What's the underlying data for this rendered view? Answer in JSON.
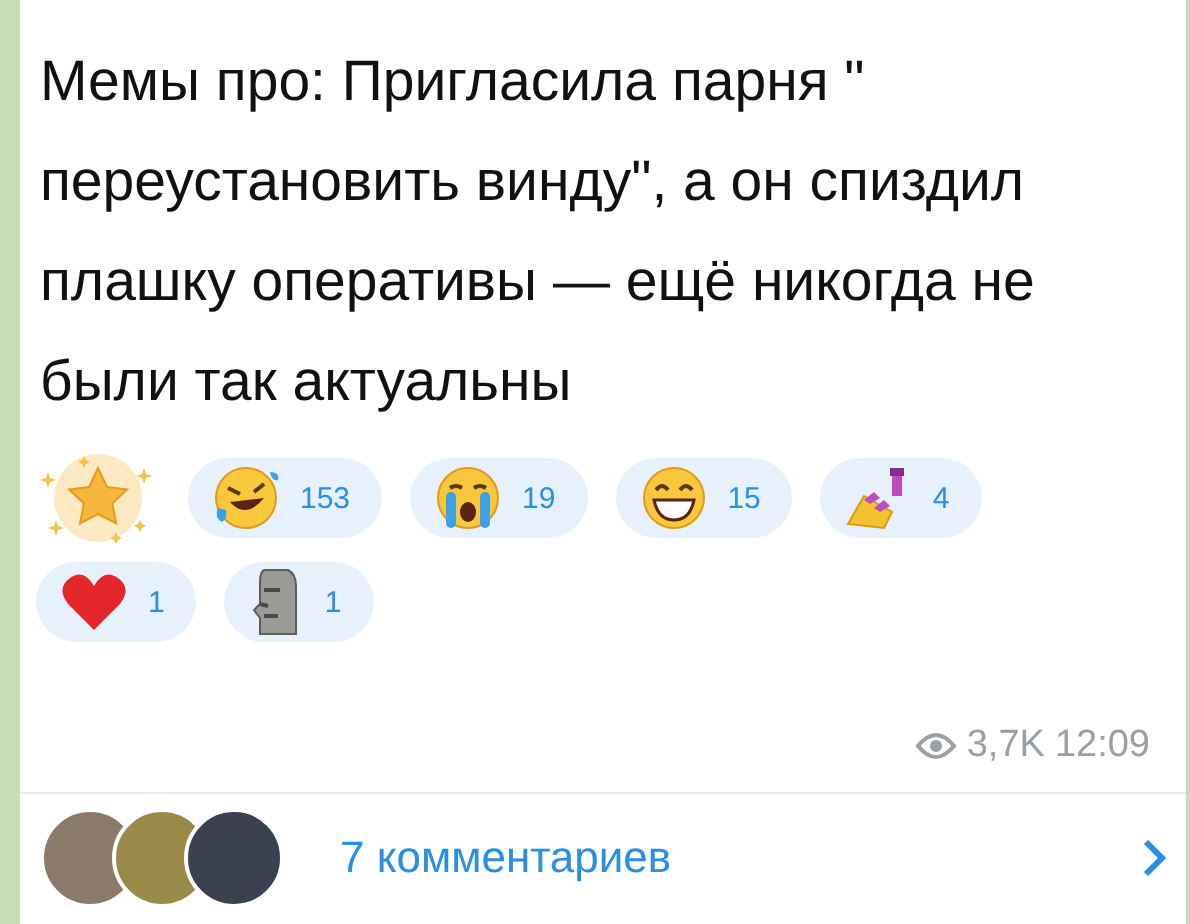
{
  "message": {
    "text": "Мемы про: Пригласила парня \" переустановить винду\", а он спиздил плашку оперативы — ещё никогда не были так актуальны",
    "reactions": [
      {
        "kind": "paid",
        "selected": false
      },
      {
        "kind": "emoji",
        "count": "153",
        "selected": false
      },
      {
        "kind": "emoji",
        "count": "19",
        "selected": false
      },
      {
        "kind": "emoji",
        "count": "15",
        "selected": false
      },
      {
        "kind": "emoji",
        "count": "4",
        "selected": false
      },
      {
        "kind": "emoji",
        "count": "1",
        "selected": false
      },
      {
        "kind": "emoji",
        "count": "1",
        "selected": false
      }
    ],
    "views": "3,7K",
    "time": "12:09"
  },
  "comments": {
    "label": "7 комментариев"
  }
}
